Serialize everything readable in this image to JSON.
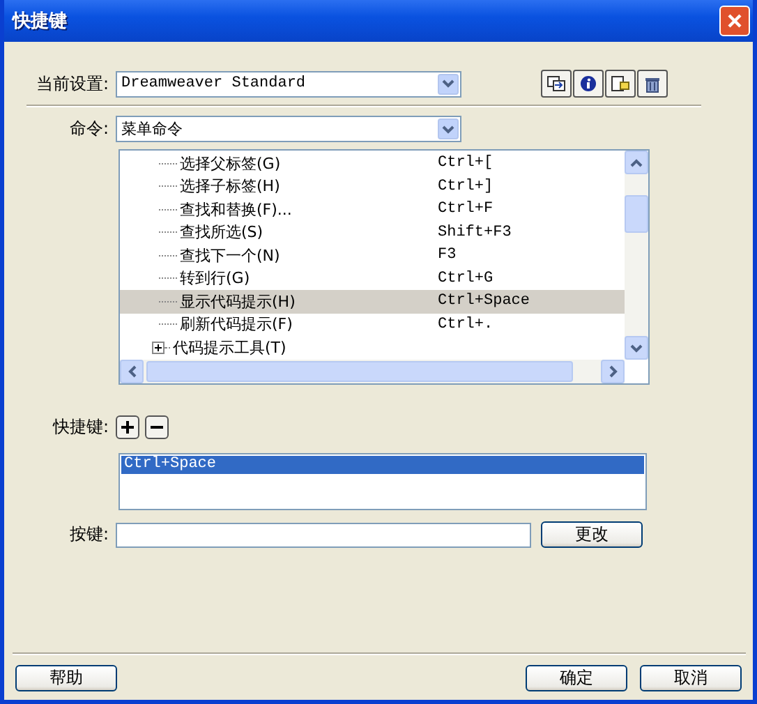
{
  "window": {
    "title": "快捷键"
  },
  "current_setting": {
    "label": "当前设置:",
    "value": "Dreamweaver Standard"
  },
  "command": {
    "label": "命令:",
    "value": "菜单命令"
  },
  "tree": {
    "items": [
      {
        "kind": "leaf",
        "label": "选择父标签(G)",
        "shortcut": "Ctrl+[",
        "selected": false
      },
      {
        "kind": "leaf",
        "label": "选择子标签(H)",
        "shortcut": "Ctrl+]",
        "selected": false
      },
      {
        "kind": "leaf",
        "label": "查找和替换(F)...",
        "shortcut": "Ctrl+F",
        "selected": false
      },
      {
        "kind": "leaf",
        "label": "查找所选(S)",
        "shortcut": "Shift+F3",
        "selected": false
      },
      {
        "kind": "leaf",
        "label": "查找下一个(N)",
        "shortcut": "F3",
        "selected": false
      },
      {
        "kind": "leaf",
        "label": "转到行(G)",
        "shortcut": "Ctrl+G",
        "selected": false
      },
      {
        "kind": "leaf",
        "label": "显示代码提示(H)",
        "shortcut": "Ctrl+Space",
        "selected": true
      },
      {
        "kind": "leaf",
        "label": "刷新代码提示(F)",
        "shortcut": "Ctrl+.",
        "selected": false
      },
      {
        "kind": "folder",
        "label": "代码提示工具(T)",
        "expanded": false,
        "selected": false
      }
    ]
  },
  "shortcuts": {
    "label": "快捷键:",
    "items": [
      {
        "text": "Ctrl+Space",
        "selected": true
      }
    ]
  },
  "key": {
    "label": "按键:",
    "button": "更改"
  },
  "buttons": {
    "help": "帮助",
    "ok": "确定",
    "cancel": "取消"
  }
}
